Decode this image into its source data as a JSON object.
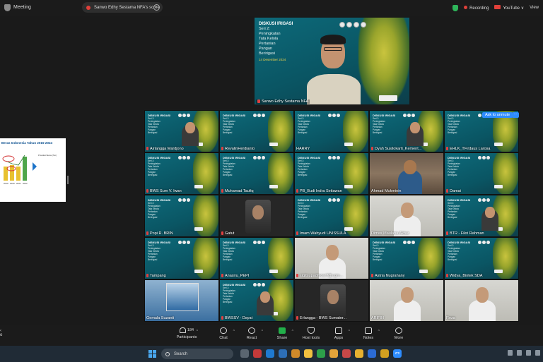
{
  "topbar": {
    "app_title": "Meeting",
    "share_pill_text": "Sanwo Edhy Sestama NFA's scree",
    "more_symbol": "⋯",
    "recording_label": "Recording",
    "youtube_label": "YouTube",
    "view_label": "View",
    "caret": "∨"
  },
  "shared_slide": {
    "title": "Beras Indonesia Tahun 2015-2024",
    "years": [
      "2019",
      "2020",
      "2021",
      "2022"
    ],
    "caption": "Produksi Beras (Ton)"
  },
  "speaker": {
    "slide_title": "DISKUSI IRIGASI",
    "slide_series": "Seri 2:",
    "slide_lines": [
      "Peningkatan",
      "Tata Kelola",
      "Pertanian",
      "Pangan",
      "Beririgasi"
    ],
    "slide_date": "14 Desember 2024",
    "name": "Sanwo Edhy Sestama NFA",
    "accent": "#0a5563"
  },
  "tiles": [
    {
      "name": "Airlangga Mardjono",
      "muted": true,
      "kind": "slide-person"
    },
    {
      "name": "RevalinHerdianto",
      "muted": true,
      "kind": "slide"
    },
    {
      "name": "HARRY",
      "muted": false,
      "kind": "slide"
    },
    {
      "name": "Dyah Susilokarti_Kement...",
      "muted": true,
      "kind": "slide-person"
    },
    {
      "name": "EHLK_TFirdaus Larosa",
      "muted": true,
      "kind": "slide"
    },
    {
      "name": "BWS Sum V. Iwan",
      "muted": true,
      "kind": "slide"
    },
    {
      "name": "Muhamad Taufiq",
      "muted": true,
      "kind": "slide"
    },
    {
      "name": "PB_Budi Indra Setiawan",
      "muted": true,
      "kind": "slide"
    },
    {
      "name": "Ahmad Mukminin",
      "muted": false,
      "kind": "room"
    },
    {
      "name": "Damai",
      "muted": true,
      "kind": "slide"
    },
    {
      "name": "Popi R. BRIN",
      "muted": true,
      "kind": "slide"
    },
    {
      "name": "Gatut",
      "muted": true,
      "kind": "dark-person"
    },
    {
      "name": "Imam Wahyudi UNISSULA",
      "muted": true,
      "kind": "slide"
    },
    {
      "name": "Dimas Maulana Akbar",
      "muted": false,
      "kind": "light-person"
    },
    {
      "name": "BTR - Fikri Rahman",
      "muted": true,
      "kind": "slide-person"
    },
    {
      "name": "Tampang",
      "muted": true,
      "kind": "slide"
    },
    {
      "name": "Anasiru_PEPI",
      "muted": true,
      "kind": "slide"
    },
    {
      "name": "sigitsupadmoarif@ugm...",
      "muted": true,
      "kind": "light-person"
    },
    {
      "name": "Astria Nugrahany",
      "muted": true,
      "kind": "slide"
    },
    {
      "name": "Widya_Bintek SDA",
      "muted": true,
      "kind": "slide"
    },
    {
      "name": "Gemala Suzanti",
      "muted": false,
      "kind": "blue"
    },
    {
      "name": "BWSSV - Dayat",
      "muted": true,
      "kind": "slide-person"
    },
    {
      "name": "Erlangga - BWS Sumater...",
      "muted": true,
      "kind": "dark-person"
    },
    {
      "name": "ARIFIN",
      "muted": false,
      "kind": "light-person"
    },
    {
      "name": "Reza",
      "muted": false,
      "kind": "light-person"
    }
  ],
  "ask_unmute": "Ask to unmute",
  "toolbar": {
    "left_fragment": "o",
    "participants_label": "Participants",
    "participants_count": "184",
    "chat_label": "Chat",
    "react_label": "React",
    "share_label": "Share",
    "host_tools_label": "Host tools",
    "apps_label": "Apps",
    "notes_label": "Notes",
    "more_label": "More",
    "caret": "^"
  },
  "taskbar": {
    "search_label": "Search",
    "zoom_label": "zm"
  }
}
